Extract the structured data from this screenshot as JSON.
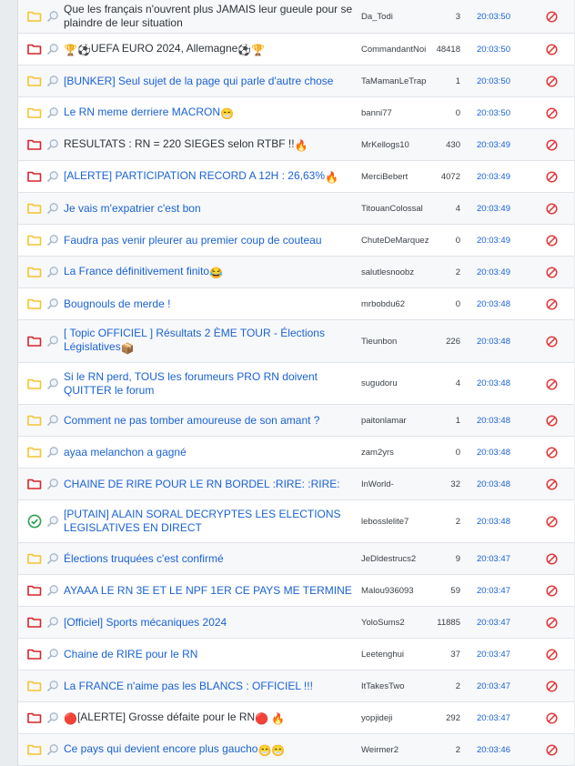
{
  "colors": {
    "folder_yellow": "#f4c430",
    "folder_red": "#d8232a",
    "link_blue": "#1a62d4",
    "ban_red": "#e03a3a",
    "check_green": "#2aa34a"
  },
  "rows": [
    {
      "icon": "folder-yellow",
      "subject": "Que les français n'ouvrent plus JAMAIS leur gueule pour se plaindre de leur situation",
      "subject_color": "dark",
      "author": "Da_Todi",
      "count": "3",
      "time": "20:03:50",
      "emoji_pre": "",
      "emoji_post": ""
    },
    {
      "icon": "folder-red",
      "subject": "UEFA EURO 2024, Allemagne",
      "subject_color": "dark",
      "author": "CommandantNoi",
      "count": "48418",
      "time": "20:03:50",
      "emoji_pre": "🏆⚽",
      "emoji_post": "⚽🏆"
    },
    {
      "icon": "folder-yellow",
      "subject": "[BUNKER] Seul sujet de la page qui parle d'autre chose",
      "subject_color": "blue",
      "author": "TaMamanLeTrap",
      "count": "1",
      "time": "20:03:50",
      "emoji_pre": "",
      "emoji_post": ""
    },
    {
      "icon": "folder-yellow",
      "subject": "Le RN meme derriere MACRON",
      "subject_color": "blue",
      "author": "banni77",
      "count": "0",
      "time": "20:03:50",
      "emoji_pre": "",
      "emoji_post": "😁"
    },
    {
      "icon": "folder-red",
      "subject": "RESULTATS : RN = 220 SIEGES selon RTBF !!",
      "subject_color": "dark",
      "author": "MrKellogs10",
      "count": "430",
      "time": "20:03:49",
      "emoji_pre": "",
      "emoji_post": "🔥"
    },
    {
      "icon": "folder-red",
      "subject": "[ALERTE] PARTICIPATION RECORD A 12H : 26,63%",
      "subject_color": "blue",
      "author": "MerciBebert",
      "count": "4072",
      "time": "20:03:49",
      "emoji_pre": "",
      "emoji_post": "🔥"
    },
    {
      "icon": "folder-yellow",
      "subject": "Je vais m'expatrier c'est bon",
      "subject_color": "blue",
      "author": "TitouanColossal",
      "count": "4",
      "time": "20:03:49",
      "emoji_pre": "",
      "emoji_post": ""
    },
    {
      "icon": "folder-yellow",
      "subject": "Faudra pas venir pleurer au premier coup de couteau",
      "subject_color": "blue",
      "author": "ChuteDeMarquez",
      "count": "0",
      "time": "20:03:49",
      "emoji_pre": "",
      "emoji_post": ""
    },
    {
      "icon": "folder-yellow",
      "subject": "La France définitivement finito",
      "subject_color": "blue",
      "author": "salutlesnoobz",
      "count": "2",
      "time": "20:03:49",
      "emoji_pre": "",
      "emoji_post": "😂"
    },
    {
      "icon": "folder-yellow",
      "subject": "Bougnouls de merde !",
      "subject_color": "blue",
      "author": "mrbobdu62",
      "count": "0",
      "time": "20:03:48",
      "emoji_pre": "",
      "emoji_post": ""
    },
    {
      "icon": "folder-red",
      "subject": "[ Topic OFFICIEL ] Résultats 2 ÈME TOUR - Élections Législatives",
      "subject_color": "blue",
      "author": "Tieunbon",
      "count": "226",
      "time": "20:03:48",
      "emoji_pre": "",
      "emoji_post": "📦"
    },
    {
      "icon": "folder-yellow",
      "subject": "Si le RN perd, TOUS les forumeurs PRO RN doivent QUITTER le forum",
      "subject_color": "blue",
      "author": "sugudoru",
      "count": "4",
      "time": "20:03:48",
      "emoji_pre": "",
      "emoji_post": ""
    },
    {
      "icon": "folder-yellow",
      "subject": "Comment ne pas tomber amoureuse de son amant ?",
      "subject_color": "blue",
      "author": "paitonlamar",
      "count": "1",
      "time": "20:03:48",
      "emoji_pre": "",
      "emoji_post": ""
    },
    {
      "icon": "folder-yellow",
      "subject": "ayaa melanchon a gagné",
      "subject_color": "blue",
      "author": "zam2yrs",
      "count": "0",
      "time": "20:03:48",
      "emoji_pre": "",
      "emoji_post": ""
    },
    {
      "icon": "folder-red",
      "subject": "CHAINE DE RIRE POUR LE RN BORDEL :RIRE: :RIRE:",
      "subject_color": "blue",
      "author": "InWorld-",
      "count": "32",
      "time": "20:03:48",
      "emoji_pre": "",
      "emoji_post": ""
    },
    {
      "icon": "check-green",
      "subject": "[PUTAIN] ALAIN SORAL DECRYPTES LES ELECTIONS LEGISLATIVES EN DIRECT",
      "subject_color": "blue",
      "author": "lebosslelite7",
      "count": "2",
      "time": "20:03:48",
      "emoji_pre": "",
      "emoji_post": ""
    },
    {
      "icon": "folder-yellow",
      "subject": "Élections truquées c'est confirmé",
      "subject_color": "blue",
      "author": "JeDldestrucs2",
      "count": "9",
      "time": "20:03:47",
      "emoji_pre": "",
      "emoji_post": ""
    },
    {
      "icon": "folder-red",
      "subject": "AYAAA LE RN 3E ET LE NPF 1ER CE PAYS ME TERMINE",
      "subject_color": "blue",
      "author": "Malou936093",
      "count": "59",
      "time": "20:03:47",
      "emoji_pre": "",
      "emoji_post": ""
    },
    {
      "icon": "folder-red",
      "subject": "[Officiel] Sports mécaniques 2024",
      "subject_color": "blue",
      "author": "YoloSums2",
      "count": "11885",
      "time": "20:03:47",
      "emoji_pre": "",
      "emoji_post": ""
    },
    {
      "icon": "folder-red",
      "subject": "Chaine de RIRE pour le RN",
      "subject_color": "blue",
      "author": "Leetenghui",
      "count": "37",
      "time": "20:03:47",
      "emoji_pre": "",
      "emoji_post": ""
    },
    {
      "icon": "folder-yellow",
      "subject": "La FRANCE n'aime pas les BLANCS : OFFICIEL !!!",
      "subject_color": "blue",
      "author": "ItTakesTwo",
      "count": "2",
      "time": "20:03:47",
      "emoji_pre": "",
      "emoji_post": ""
    },
    {
      "icon": "folder-red",
      "subject": "[ALERTE] Grosse défaite pour le RN",
      "subject_color": "dark",
      "author": "yopjideji",
      "count": "292",
      "time": "20:03:47",
      "emoji_pre": "🔴",
      "emoji_post": "🔴 🔥"
    },
    {
      "icon": "folder-yellow",
      "subject": "Ce pays qui devient encore plus gaucho",
      "subject_color": "blue",
      "author": "Weirmer2",
      "count": "2",
      "time": "20:03:46",
      "emoji_pre": "",
      "emoji_post": "😁😁"
    }
  ]
}
